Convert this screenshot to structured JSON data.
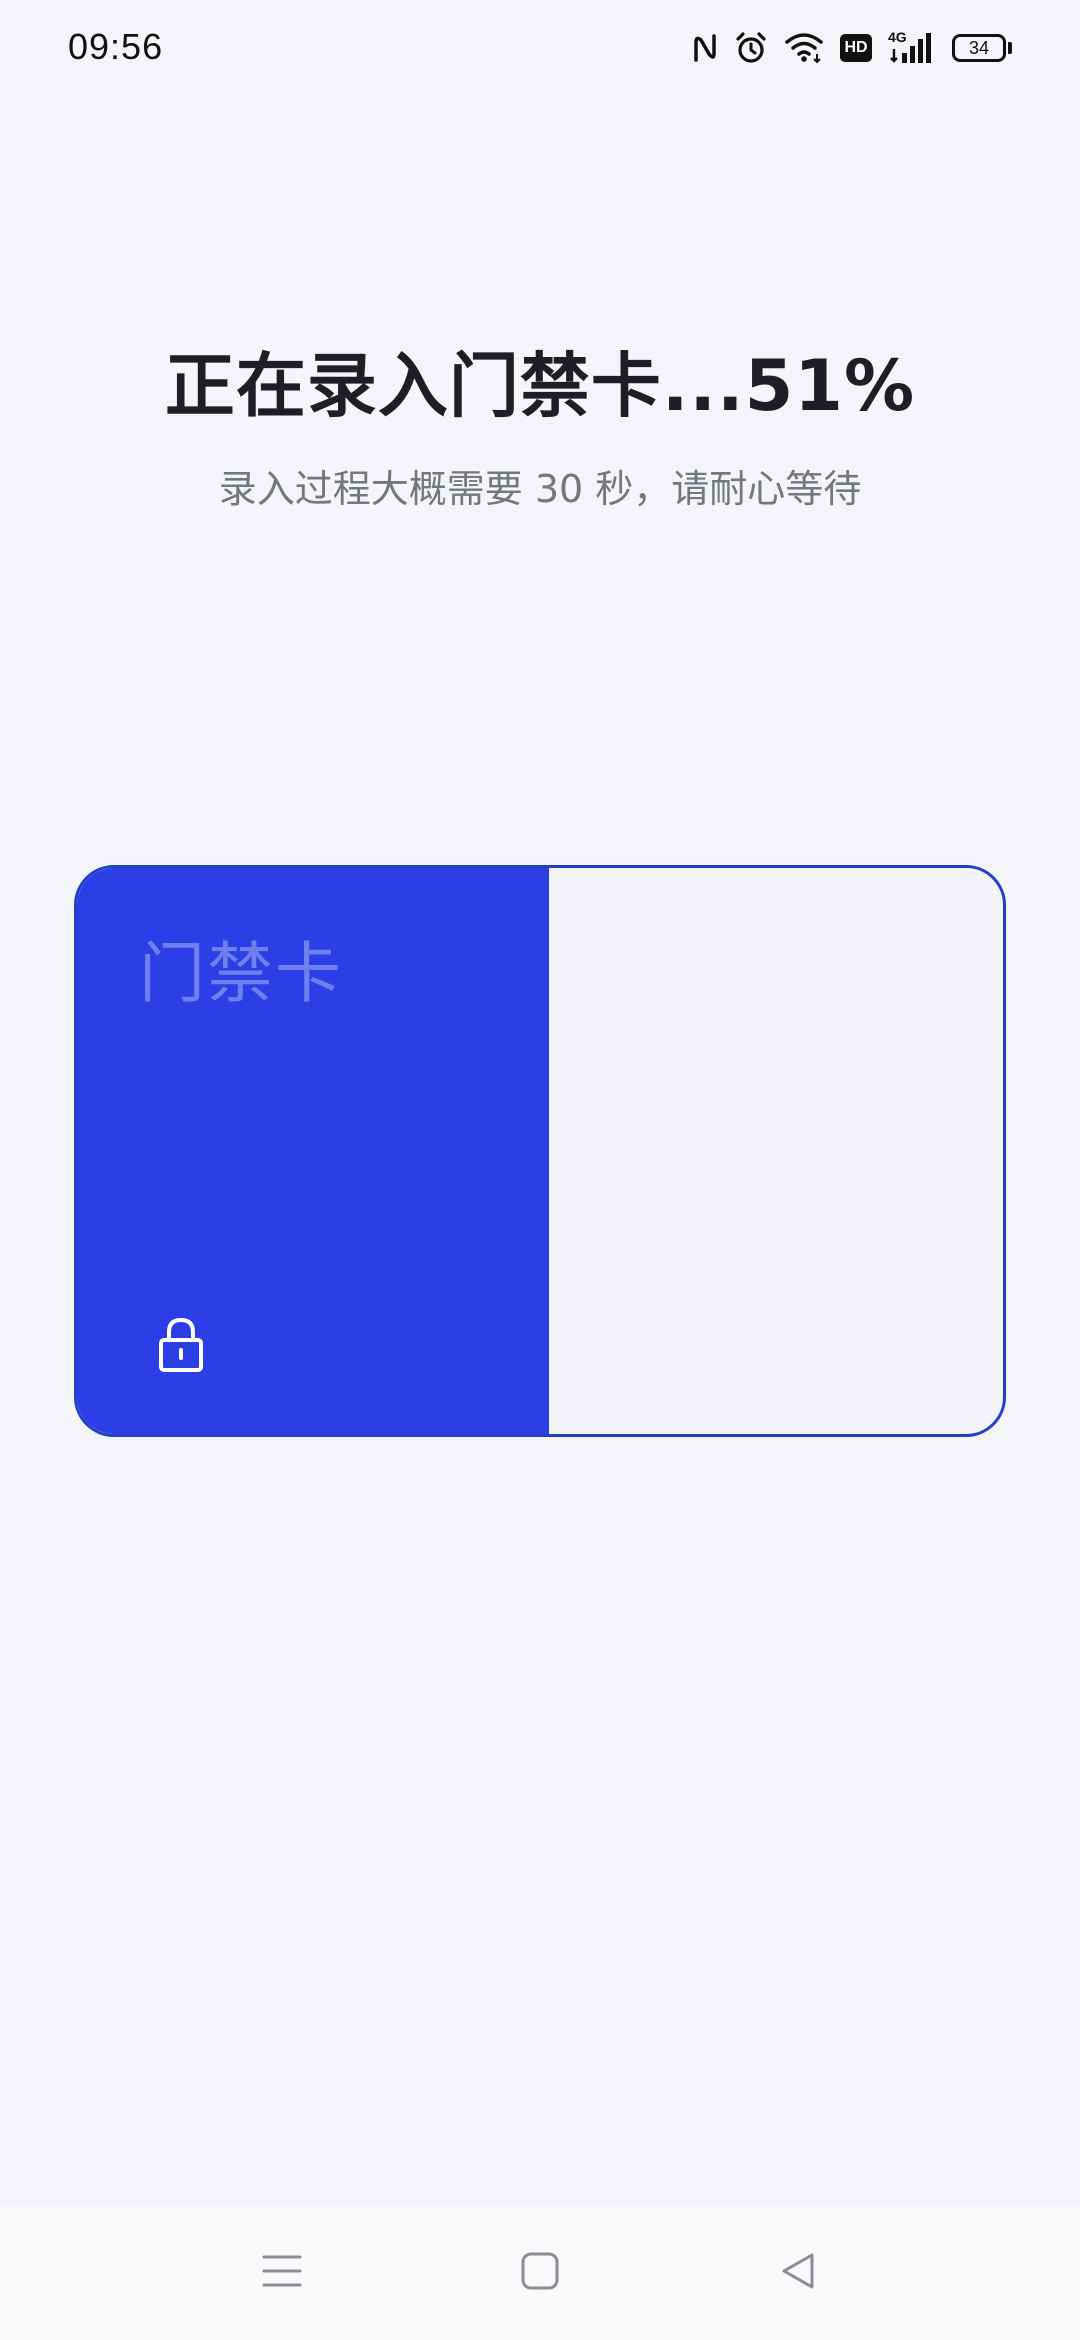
{
  "status_bar": {
    "time": "09:56",
    "network_label": "4G",
    "hd_label": "HD",
    "battery_level": "34",
    "icons": [
      "nfc-icon",
      "alarm-icon",
      "wifi-icon",
      "hd-icon",
      "cellular-4g-icon",
      "battery-icon"
    ]
  },
  "enroll": {
    "title": "正在录入门禁卡...51%",
    "subtitle": "录入过程大概需要 30 秒，请耐心等待",
    "progress_fraction": 0.51
  },
  "card": {
    "label": "门禁卡",
    "icon": "lock-icon",
    "fill_color": "#2c3fe6",
    "border_color": "#2240c6"
  },
  "nav_bar": {
    "icons": [
      "menu-icon",
      "home-icon",
      "back-icon"
    ]
  }
}
